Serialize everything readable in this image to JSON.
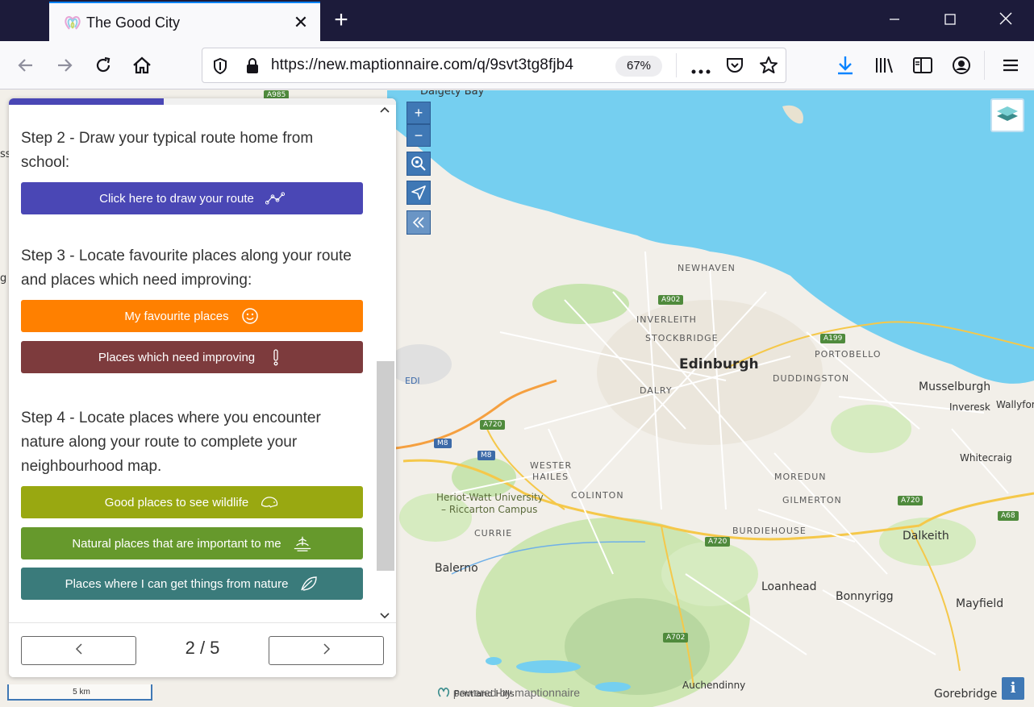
{
  "browser": {
    "tab_title": "The Good City",
    "tab_close": "✕",
    "new_tab": "+",
    "url": "https://new.maptionnaire.com/q/9svt3tg8fjb4",
    "zoom": "67%"
  },
  "panel": {
    "progress": 0.4,
    "step2": {
      "text": "Step 2 - Draw your typical route home from school:",
      "button_label": "Click here to draw your route",
      "button_color": "#4a47b5"
    },
    "step3": {
      "text": "Step 3 - Locate favourite places along your route and places which need improving:",
      "buttons": [
        {
          "label": "My favourite places",
          "color": "#ff8000",
          "icon": "smiley-icon"
        },
        {
          "label": "Places which need improving",
          "color": "#7d3b3d",
          "icon": "exclamation-icon"
        }
      ]
    },
    "step4": {
      "text": "Step 4 - Locate places where you encounter nature along your route to complete your neighbourhood map.",
      "buttons": [
        {
          "label": "Good places to see wildlife",
          "color": "#99a811",
          "icon": "hedgehog-icon"
        },
        {
          "label": "Natural places that are important to me",
          "color": "#66992c",
          "icon": "landscape-icon"
        },
        {
          "label": "Places where I can get things from nature",
          "color": "#3a7b7b",
          "icon": "leaf-icon"
        }
      ]
    },
    "pager": {
      "text": "2 / 5",
      "prev": "‹",
      "next": "›"
    }
  },
  "map": {
    "zoom_in": "+",
    "zoom_out": "−",
    "scale_label": "5 km",
    "powered_by": "powered by maptionnaire",
    "info": "i",
    "labels": {
      "dalgety_bay": "Dalgety Bay",
      "newhaven": "NEWHAVEN",
      "inverleith": "INVERLEITH",
      "stockbridge": "STOCKBRIDGE",
      "edinburgh": "Edinburgh",
      "portobello": "PORTOBELLO",
      "duddingston": "DUDDINGSTON",
      "dalry": "DALRY",
      "edi": "EDI",
      "musselburgh": "Musselburgh",
      "inveresk": "Inveresk",
      "wallyford": "Wallyfor",
      "whitecraig": "Whitecraig",
      "wester_hailes_1": "WESTER",
      "wester_hailes_2": "HAILES",
      "colinton": "COLINTON",
      "moredun": "MOREDUN",
      "gilmerton": "GILMERTON",
      "uni_1": "Heriot-Watt University",
      "uni_2": "– Riccarton Campus",
      "currie": "CURRIE",
      "burdiehouse": "BURDIEHOUSE",
      "dalkeith": "Dalkeith",
      "balerno": "Balerno",
      "loanhead": "Loanhead",
      "bonnyrigg": "Bonnyrigg",
      "mayfield": "Mayfield",
      "auchendinny": "Auchendinny",
      "gorebridge": "Gorebridge",
      "pentland": "Pentland Hills",
      "edge_ss": "ss",
      "edge_g": "g"
    },
    "roads": {
      "a985": "A985",
      "a902": "A902",
      "a199": "A199",
      "a720a": "A720",
      "a720b": "A720",
      "a720c": "A720",
      "m8a": "M8",
      "m8b": "M8",
      "a68": "A68",
      "a702": "A702"
    }
  }
}
